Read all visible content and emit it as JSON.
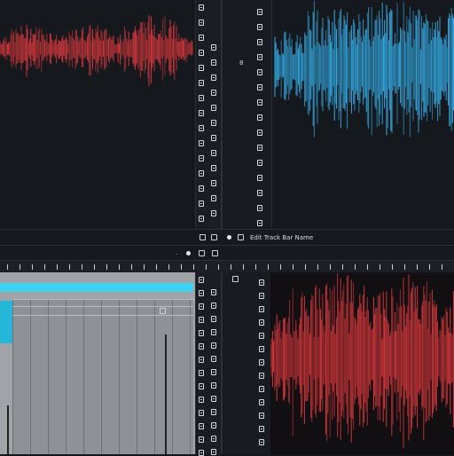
{
  "colors": {
    "background": "#14171c",
    "waveform_red": "#e23a3e",
    "waveform_blue": "#36b4f0",
    "accent_pink": "#ff2f7a",
    "accent_cyan": "#3ed3f2"
  },
  "toolbar": {
    "track_label": "Edit Track Bar Name",
    "track_number": "8"
  },
  "panes": [
    {
      "id": "top-left",
      "waveform": "red"
    },
    {
      "id": "top-right",
      "waveform": "blue"
    },
    {
      "id": "bottom-left",
      "content": "clip-grid"
    },
    {
      "id": "bottom-right",
      "waveform": "red"
    }
  ],
  "icons": [
    "track-button-icon",
    "play-dot-icon",
    "pink-marker-icon",
    "fader-icon"
  ]
}
